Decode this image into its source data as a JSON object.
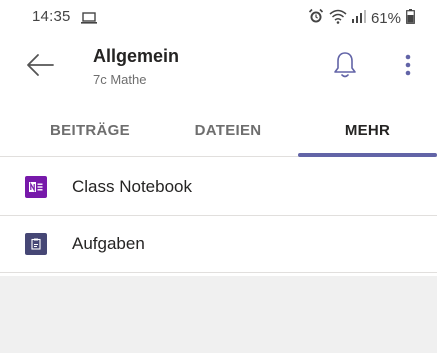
{
  "status_bar": {
    "time": "14:35",
    "battery": "61%",
    "icons": [
      "screen-cast-icon",
      "alarm-icon",
      "wifi-icon",
      "signal-icon",
      "battery-icon"
    ]
  },
  "header": {
    "title": "Allgemein",
    "subtitle": "7c Mathe",
    "icons": [
      "back-arrow-icon",
      "bell-icon",
      "more-vertical-icon"
    ]
  },
  "tabs": [
    {
      "label": "BEITRÄGE",
      "active": false
    },
    {
      "label": "DATEIEN",
      "active": false
    },
    {
      "label": "MEHR",
      "active": true
    }
  ],
  "list": [
    {
      "label": "Class Notebook",
      "icon": "onenote-icon",
      "icon_color": "#7719aa"
    },
    {
      "label": "Aufgaben",
      "icon": "assignments-icon",
      "icon_color": "#464775"
    }
  ],
  "colors": {
    "accent": "#6264a7",
    "background": "#f0f0f0",
    "surface": "#ffffff"
  }
}
